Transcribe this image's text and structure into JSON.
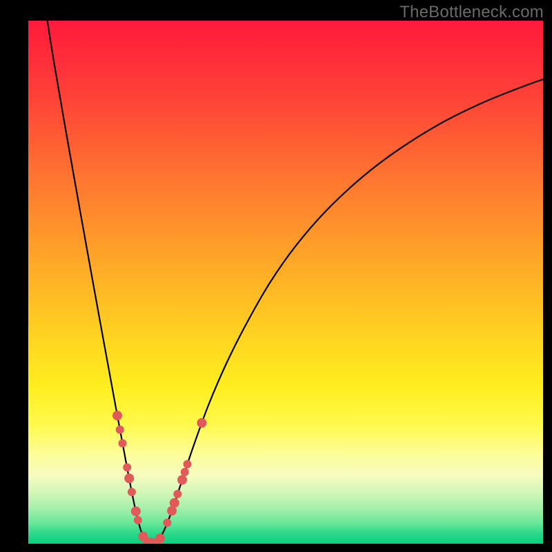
{
  "watermark": "TheBottleneck.com",
  "chart_data": {
    "type": "line",
    "title": "",
    "xlabel": "",
    "ylabel": "",
    "xlim": [
      0,
      100
    ],
    "ylim": [
      0,
      100
    ],
    "grid": false,
    "legend": false,
    "curve": {
      "name": "bottleneck-vs-x",
      "note": "y is bottleneck % (0 at bottom/green, 100 at top/red). Minimum (optimal match) around x≈24.",
      "points": [
        {
          "x": 3.7,
          "y": 100.0
        },
        {
          "x": 5.0,
          "y": 92.0
        },
        {
          "x": 7.0,
          "y": 80.6
        },
        {
          "x": 9.0,
          "y": 69.5
        },
        {
          "x": 11.0,
          "y": 58.5
        },
        {
          "x": 13.0,
          "y": 47.6
        },
        {
          "x": 15.0,
          "y": 36.8
        },
        {
          "x": 17.0,
          "y": 26.1
        },
        {
          "x": 18.5,
          "y": 18.2
        },
        {
          "x": 20.0,
          "y": 10.4
        },
        {
          "x": 21.2,
          "y": 4.9
        },
        {
          "x": 22.3,
          "y": 1.4
        },
        {
          "x": 23.4,
          "y": 0.2
        },
        {
          "x": 24.7,
          "y": 0.2
        },
        {
          "x": 26.0,
          "y": 1.8
        },
        {
          "x": 27.6,
          "y": 5.5
        },
        {
          "x": 29.5,
          "y": 11.0
        },
        {
          "x": 32.0,
          "y": 18.4
        },
        {
          "x": 35.0,
          "y": 26.5
        },
        {
          "x": 38.5,
          "y": 34.5
        },
        {
          "x": 42.5,
          "y": 42.3
        },
        {
          "x": 47.0,
          "y": 50.0
        },
        {
          "x": 52.0,
          "y": 57.0
        },
        {
          "x": 58.0,
          "y": 63.8
        },
        {
          "x": 65.0,
          "y": 70.2
        },
        {
          "x": 72.0,
          "y": 75.4
        },
        {
          "x": 80.0,
          "y": 80.3
        },
        {
          "x": 88.0,
          "y": 84.2
        },
        {
          "x": 95.0,
          "y": 87.0
        },
        {
          "x": 100.0,
          "y": 88.8
        }
      ]
    },
    "markers": {
      "name": "sample-points",
      "color": "#e05a5a",
      "points": [
        {
          "x": 17.3,
          "y": 24.5,
          "r": 7
        },
        {
          "x": 17.8,
          "y": 21.8,
          "r": 6
        },
        {
          "x": 18.3,
          "y": 19.2,
          "r": 6
        },
        {
          "x": 19.2,
          "y": 14.6,
          "r": 6
        },
        {
          "x": 19.6,
          "y": 12.5,
          "r": 7
        },
        {
          "x": 20.1,
          "y": 9.9,
          "r": 6
        },
        {
          "x": 20.9,
          "y": 6.2,
          "r": 7
        },
        {
          "x": 21.3,
          "y": 4.5,
          "r": 6
        },
        {
          "x": 22.3,
          "y": 1.4,
          "r": 7
        },
        {
          "x": 23.0,
          "y": 0.5,
          "r": 6
        },
        {
          "x": 23.9,
          "y": 0.2,
          "r": 7
        },
        {
          "x": 24.7,
          "y": 0.2,
          "r": 6
        },
        {
          "x": 25.6,
          "y": 1.0,
          "r": 7
        },
        {
          "x": 27.0,
          "y": 4.0,
          "r": 6
        },
        {
          "x": 27.9,
          "y": 6.3,
          "r": 7
        },
        {
          "x": 28.4,
          "y": 7.8,
          "r": 7
        },
        {
          "x": 29.0,
          "y": 9.5,
          "r": 6
        },
        {
          "x": 29.9,
          "y": 12.2,
          "r": 7
        },
        {
          "x": 30.4,
          "y": 13.7,
          "r": 6
        },
        {
          "x": 30.9,
          "y": 15.2,
          "r": 6
        },
        {
          "x": 33.7,
          "y": 23.1,
          "r": 7
        }
      ]
    }
  }
}
